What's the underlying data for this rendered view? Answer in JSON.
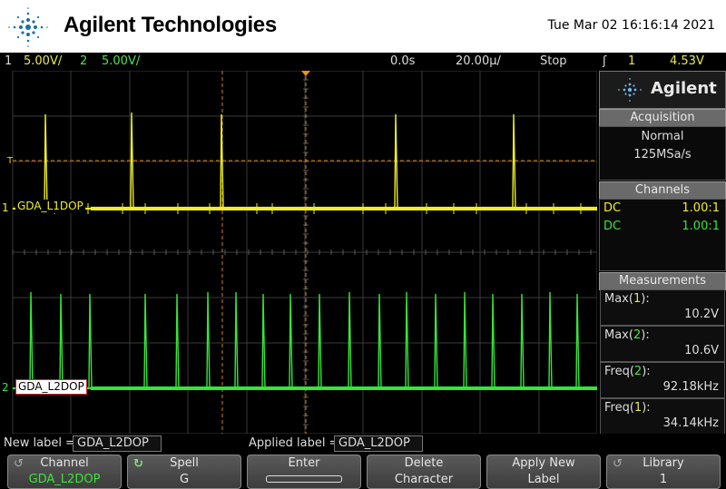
{
  "header": {
    "brand": "Agilent Technologies",
    "datetime": "Tue Mar 02 16:16:14 2021"
  },
  "statusbar": {
    "ch1_num": "1",
    "ch1_scale": "5.00V/",
    "ch2_num": "2",
    "ch2_scale": "5.00V/",
    "time_offset": "0.0s",
    "time_scale": "20.00µ/",
    "run_state": "Stop",
    "trigger_icon": "ʃ",
    "trigger_source": "1",
    "trigger_level": "4.53V"
  },
  "waveforms": {
    "ch1_label": "GDA_L1DOP",
    "ch2_label": "GDA_L2DOP",
    "ch1_color": "#f0f020",
    "ch2_color": "#36e636",
    "trigger_marker": "T",
    "ch1_marker": "1",
    "ch2_marker": "2"
  },
  "side": {
    "logo_word": "Agilent",
    "acquisition_title": "Acquisition",
    "acquisition_mode": "Normal",
    "sample_rate": "125MSa/s",
    "channels_title": "Channels",
    "channels": [
      {
        "coupling": "DC",
        "ratio": "1.00:1"
      },
      {
        "coupling": "DC",
        "ratio": "1.00:1"
      }
    ],
    "measurements_title": "Measurements",
    "measurements": [
      {
        "name": "Max",
        "ch": "1",
        "value": "10.2V"
      },
      {
        "name": "Max",
        "ch": "2",
        "value": "10.6V"
      },
      {
        "name": "Freq",
        "ch": "2",
        "value": "92.18kHz"
      },
      {
        "name": "Freq",
        "ch": "1",
        "value": "34.14kHz"
      }
    ]
  },
  "labelbar": {
    "new_label_caption": "New label =",
    "new_label_value": "GDA_L2DOP",
    "applied_caption": "Applied label =",
    "applied_value": "GDA_L2DOP"
  },
  "softkeys": [
    {
      "top": "Channel",
      "bottom": "GDA_L2DOP"
    },
    {
      "top": "Spell",
      "bottom": "G"
    },
    {
      "top": "Enter",
      "bottom": ""
    },
    {
      "top": "Delete",
      "bottom": "Character"
    },
    {
      "top": "Apply New",
      "bottom": "Label"
    },
    {
      "top": "Library",
      "bottom": "1"
    }
  ]
}
